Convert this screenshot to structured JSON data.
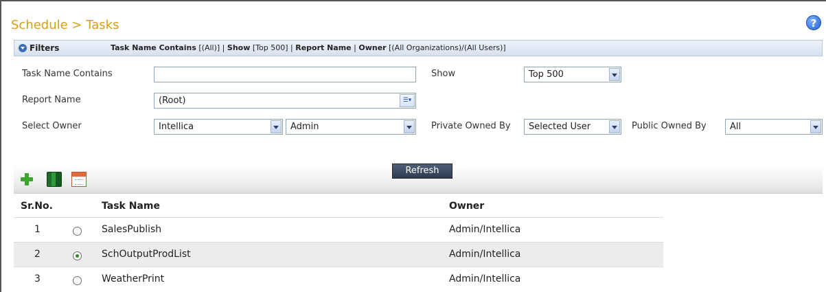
{
  "header": {
    "title": "Schedule > Tasks",
    "help_glyph": "?"
  },
  "filter_bar": {
    "toggle_label": "Filters",
    "summary": [
      {
        "key": "Task Name Contains",
        "value": "[(All)]"
      },
      {
        "key": "Show",
        "value": "[Top 500]"
      },
      {
        "key": "Report Name",
        "value": ""
      },
      {
        "key": "Owner",
        "value": "[(All Organizations)/(All Users)]"
      }
    ]
  },
  "filters": {
    "task_name_label": "Task Name Contains",
    "task_name_value": "",
    "show_label": "Show",
    "show_value": "Top 500",
    "report_name_label": "Report Name",
    "report_name_value": "(Root)",
    "select_owner_label": "Select Owner",
    "owner_org_value": "Intellica",
    "owner_user_value": "Admin",
    "private_owned_label": "Private Owned By",
    "private_owned_value": "Selected User",
    "public_owned_label": "Public Owned By",
    "public_owned_value": "All",
    "refresh_label": "Refresh"
  },
  "toolbar": {
    "icons": [
      "plus-icon",
      "books-icon",
      "calendar-icon"
    ]
  },
  "table": {
    "columns": [
      "Sr.No.",
      "Task Name",
      "Owner"
    ],
    "rows": [
      {
        "sr": "1",
        "task": "SalesPublish",
        "owner": "Admin/Intellica",
        "selected": false
      },
      {
        "sr": "2",
        "task": "SchOutputProdList",
        "owner": "Admin/Intellica",
        "selected": true
      },
      {
        "sr": "3",
        "task": "WeatherPrint",
        "owner": "Admin/Intellica",
        "selected": false
      }
    ]
  },
  "colors": {
    "title": "#d4a017",
    "filter_bar": "#d6e1ef",
    "refresh_button": "#2e3b52",
    "row_highlight": "#ececec"
  }
}
